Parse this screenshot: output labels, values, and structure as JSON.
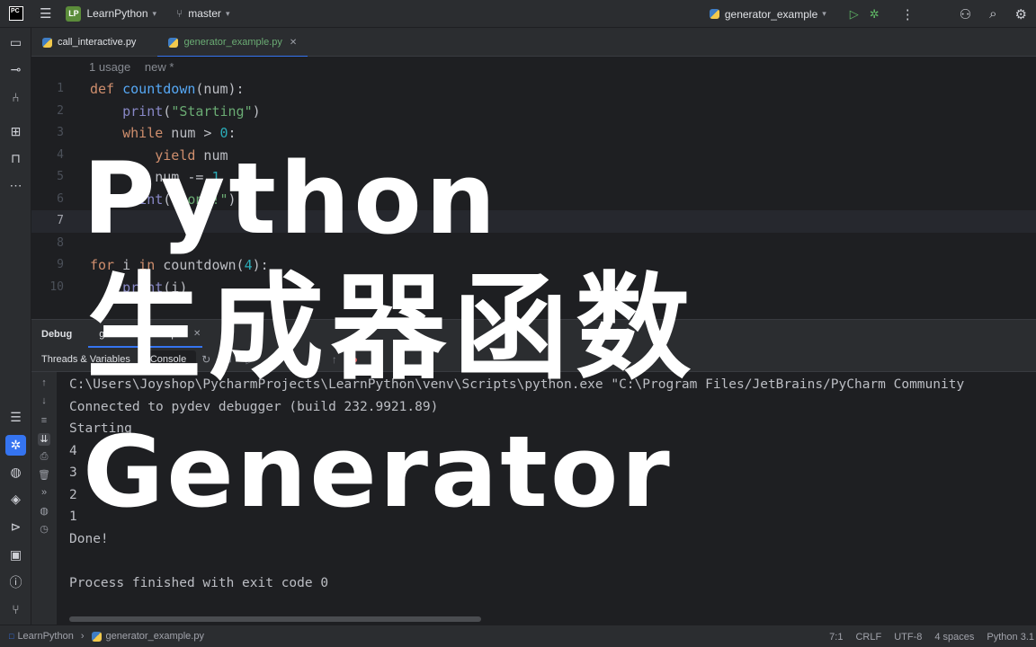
{
  "topbar": {
    "logo": "PC",
    "project_badge": "LP",
    "project_name": "LearnPython",
    "branch": "master",
    "run_config": "generator_example"
  },
  "tabs": [
    {
      "label": "call_interactive.py",
      "active": false
    },
    {
      "label": "generator_example.py",
      "active": true
    }
  ],
  "editor": {
    "hint_usage": "1 usage",
    "hint_new": "new *",
    "line_numbers": [
      "1",
      "2",
      "3",
      "4",
      "5",
      "6",
      "7",
      "8",
      "9",
      "10"
    ],
    "current_line": "7"
  },
  "debug": {
    "title": "Debug",
    "session_tab": "generator_example",
    "sub_tabs": [
      "Threads & Variables",
      "Console"
    ],
    "console_lines": [
      "C:\\Users\\Joyshop\\PycharmProjects\\LearnPython\\venv\\Scripts\\python.exe \"C:\\Program Files/JetBrains/PyCharm Community",
      "Connected to pydev debugger (build 232.9921.89)",
      "Starting",
      "4",
      "3",
      "2",
      "1",
      "Done!",
      "",
      "Process finished with exit code 0"
    ]
  },
  "status": {
    "breadcrumb_project": "LearnPython",
    "breadcrumb_file": "generator_example.py",
    "position": "7:1",
    "line_sep": "CRLF",
    "encoding": "UTF-8",
    "indent": "4 spaces",
    "interpreter": "Python 3.1"
  },
  "overlay": {
    "line1": "Python",
    "line2": "生成器函数",
    "line3": "Generator"
  },
  "colors": {
    "accent": "#3574f0",
    "keyword": "#cf8e6d",
    "function": "#56a8f5",
    "string": "#6aab73",
    "number": "#2aacb8"
  }
}
